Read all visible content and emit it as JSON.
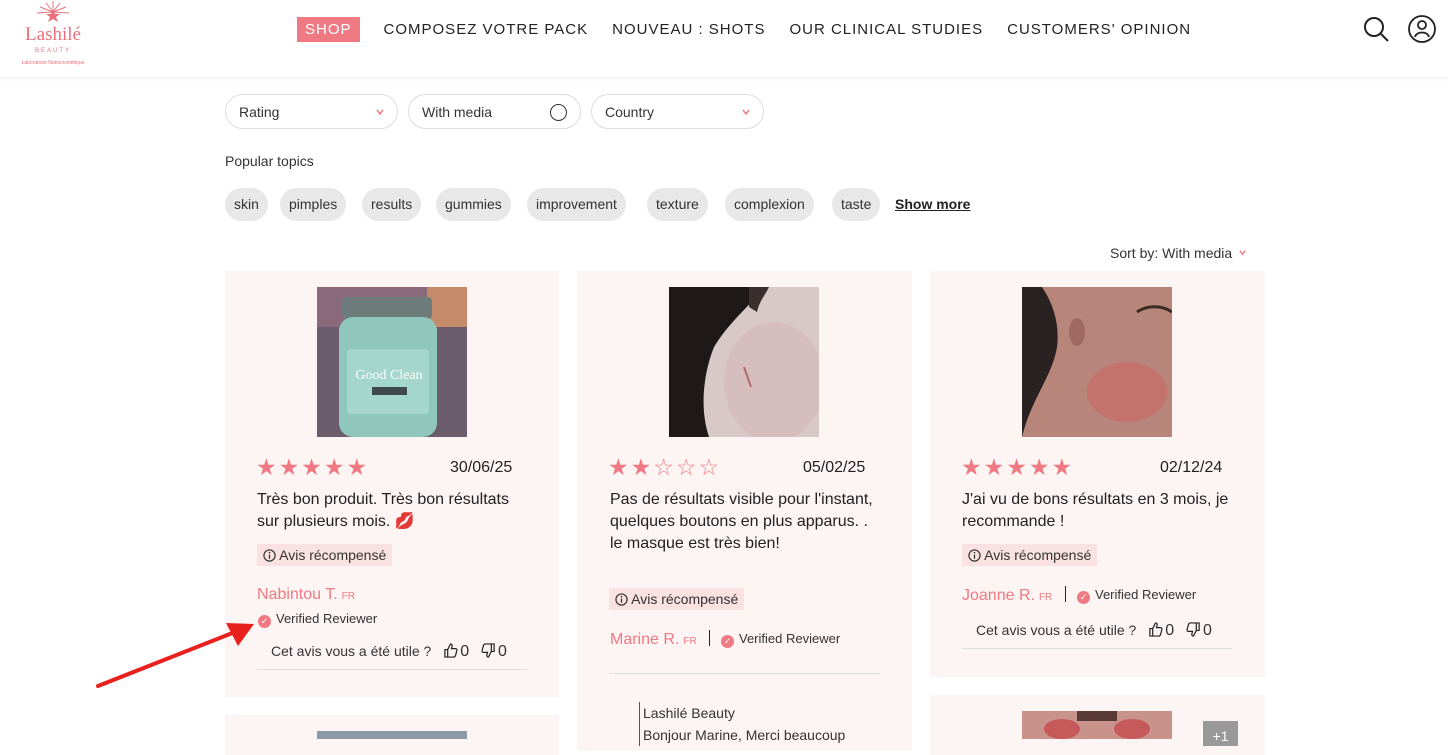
{
  "brand": {
    "name": "Lashilé",
    "sub": "BEAUTY",
    "tagline": "Laboratoire Nutricosmétique"
  },
  "nav": {
    "items": [
      "SHOP",
      "COMPOSEZ VOTRE PACK",
      "NOUVEAU : SHOTS",
      "OUR CLINICAL STUDIES",
      "CUSTOMERS' OPINION"
    ]
  },
  "filters": {
    "rating": "Rating",
    "media": "With media",
    "country": "Country"
  },
  "popular_topics": {
    "title": "Popular topics",
    "chips": [
      "skin",
      "pimples",
      "results",
      "gummies",
      "improvement",
      "texture",
      "complexion",
      "taste"
    ],
    "show_more": "Show more"
  },
  "sort": {
    "label": "Sort by:",
    "value": "With media"
  },
  "reviews": [
    {
      "rating": 5,
      "stars": "★★★★★",
      "date": "30/06/25",
      "text": "Très bon produit. Très bon résultats sur plusieurs mois. 💋",
      "badge": "Avis récompensé",
      "author": "Nabintou T.",
      "country": "FR",
      "verified": "Verified Reviewer",
      "helpful": "Cet avis vous a été utile ?",
      "up": "0",
      "down": "0"
    },
    {
      "rating": 2,
      "stars": "★★☆☆☆",
      "date": "05/02/25",
      "text": "Pas de résultats visible pour l'instant, quelques boutons en plus apparus. . le masque est très bien!",
      "badge": "Avis récompensé",
      "author": "Marine R.",
      "country": "FR",
      "verified": "Verified Reviewer",
      "reply_author": "Lashilé Beauty",
      "reply_text": "Bonjour Marine, Merci beaucoup"
    },
    {
      "rating": 5,
      "stars": "★★★★★",
      "date": "02/12/24",
      "text": "J'ai vu de bons résultats en 3 mois, je recommande !",
      "badge": "Avis récompensé",
      "author": "Joanne R.",
      "country": "FR",
      "verified": "Verified Reviewer",
      "helpful": "Cet avis vous a été utile ?",
      "up": "0",
      "down": "0"
    }
  ],
  "more_media": "+1",
  "icons": [
    "search-icon",
    "user-icon",
    "chevron-down-icon",
    "info-icon",
    "check-circle-icon",
    "thumbs-up-icon",
    "thumbs-down-icon",
    "arrow-annotation"
  ],
  "colors": {
    "accent": "#ef7a83",
    "card_bg": "#fdf4f4",
    "badge_bg": "#fbe2e2",
    "chip_bg": "#e8e8e8",
    "annotation": "#e8201e"
  }
}
